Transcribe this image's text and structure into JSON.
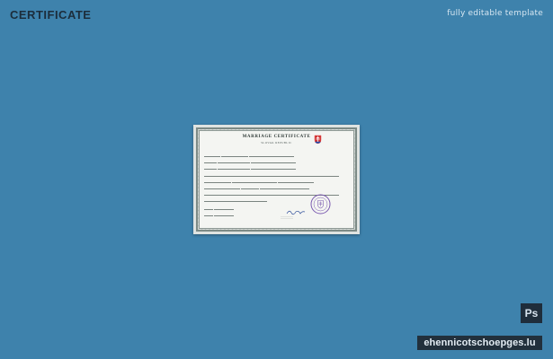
{
  "header": {
    "title": "CERTIFICATE",
    "tagline": "fully editable template"
  },
  "certificate": {
    "title": "MARRIAGE CERTIFICATE",
    "subtitle": "SLOVAK REPUBLIC",
    "emblem": "slovak-coat-of-arms-icon",
    "seal": "official-purple-seal",
    "colors": {
      "background": "#3e82ac",
      "paper": "#f4f5f2",
      "border": "#7c8a86",
      "seal": "#7a5ab0",
      "ink": "#243a66"
    }
  },
  "badges": {
    "app": "Ps",
    "watermark": "ehennicotschoepges.lu"
  }
}
